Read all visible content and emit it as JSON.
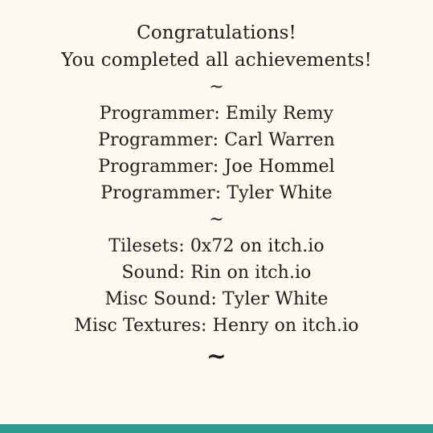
{
  "header": {
    "congrats": "Congratulations!",
    "completed": "You completed all achievements!"
  },
  "separator": "~",
  "programmers": [
    "Programmer: Emily Remy",
    "Programmer: Carl Warren",
    "Programmer: Joe Hommel",
    "Programmer: Tyler White"
  ],
  "assets": [
    "Tilesets: 0x72 on itch.io",
    "Sound: Rin on itch.io",
    "Misc Sound: Tyler White",
    "Misc Textures: Henry on itch.io"
  ],
  "colors": {
    "background": "#fdf9ee",
    "text": "#1e1e1e",
    "accent_bar": "#2a9d8f"
  }
}
